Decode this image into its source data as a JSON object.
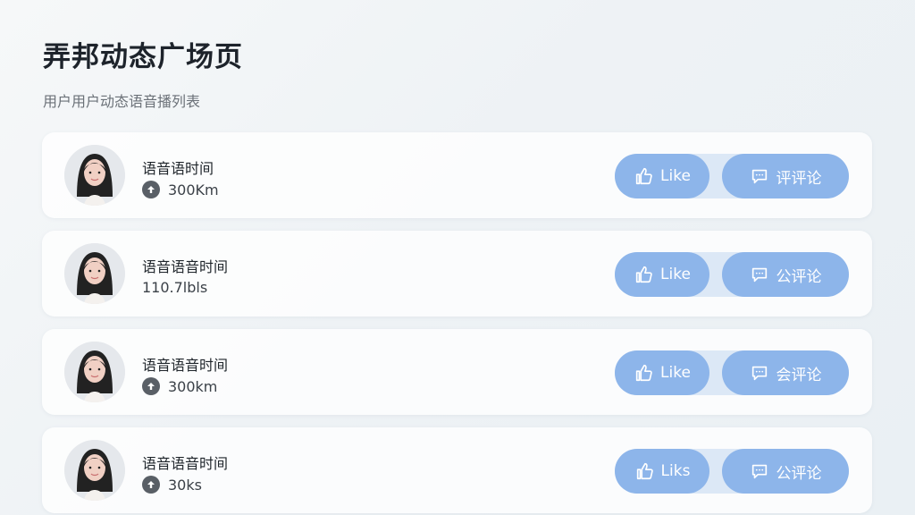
{
  "page": {
    "title": "弄邦动态广场页",
    "subtitle": "用户用户动态语音播列表"
  },
  "feed": {
    "items": [
      {
        "title": "语音语时间",
        "meta_icon": "arrow-up-icon",
        "meta_text": "300Km",
        "like_label": "Like",
        "comment_label": "评评论"
      },
      {
        "title": "语音语音时间",
        "meta_icon": "",
        "meta_text": "110.7lbls",
        "like_label": "Like",
        "comment_label": "公评论"
      },
      {
        "title": "语音语音时间",
        "meta_icon": "arrow-up-icon",
        "meta_text": "300km",
        "like_label": "Like",
        "comment_label": "会评论"
      },
      {
        "title": "语音语音时间",
        "meta_icon": "arrow-up-icon",
        "meta_text": "30ks",
        "like_label": "Liks",
        "comment_label": "公评论"
      }
    ]
  },
  "colors": {
    "button": "#8db5ea",
    "button_track": "#dce8f6",
    "title": "#1d232b",
    "subtitle": "#6b7178"
  }
}
